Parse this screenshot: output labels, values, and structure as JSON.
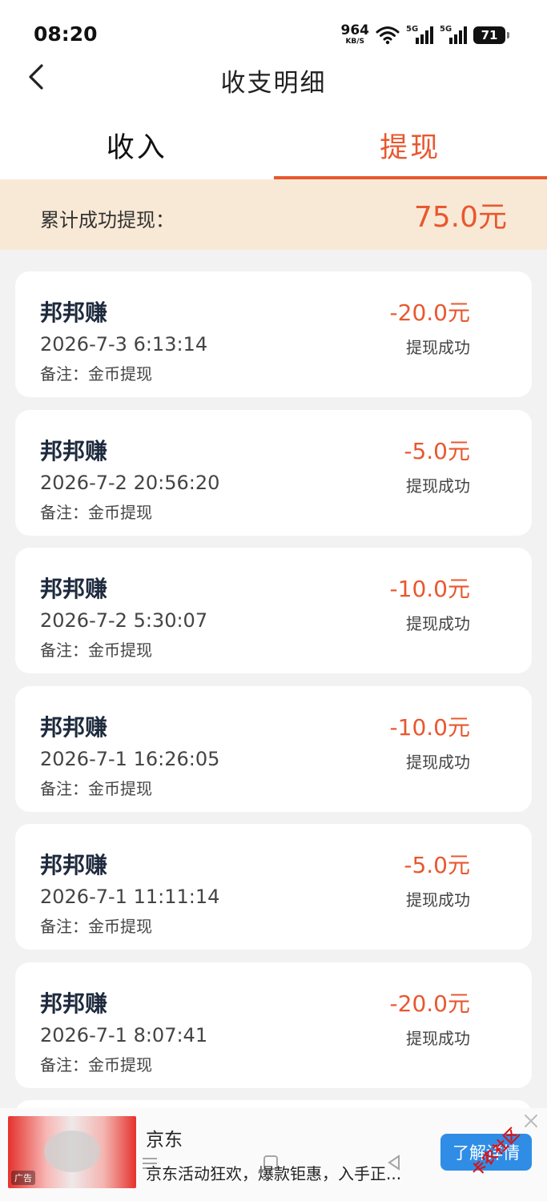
{
  "status_bar": {
    "time": "08:20",
    "net_speed": "964",
    "net_unit": "KB/S",
    "signal_tag": "5G",
    "battery": "71"
  },
  "header": {
    "title": "收支明细"
  },
  "tabs": [
    {
      "label": "收入",
      "active": false
    },
    {
      "label": "提现",
      "active": true
    }
  ],
  "summary": {
    "label": "累计成功提现：",
    "amount": "75.0元"
  },
  "records": [
    {
      "title": "邦邦赚",
      "date": "2026-7-3 6:13:14",
      "note": "备注：金币提现",
      "amount": "-20.0元",
      "status": "提现成功"
    },
    {
      "title": "邦邦赚",
      "date": "2026-7-2 20:56:20",
      "note": "备注：金币提现",
      "amount": "-5.0元",
      "status": "提现成功"
    },
    {
      "title": "邦邦赚",
      "date": "2026-7-2 5:30:07",
      "note": "备注：金币提现",
      "amount": "-10.0元",
      "status": "提现成功"
    },
    {
      "title": "邦邦赚",
      "date": "2026-7-1 16:26:05",
      "note": "备注：金币提现",
      "amount": "-10.0元",
      "status": "提现成功"
    },
    {
      "title": "邦邦赚",
      "date": "2026-7-1 11:11:14",
      "note": "备注：金币提现",
      "amount": "-5.0元",
      "status": "提现成功"
    },
    {
      "title": "邦邦赚",
      "date": "2026-7-1 8:07:41",
      "note": "备注：金币提现",
      "amount": "-20.0元",
      "status": "提现成功"
    }
  ],
  "ad": {
    "badge": "广告",
    "title": "京东",
    "description": "京东活动狂欢，爆款钜惠，入手正...",
    "button": "了解详情"
  },
  "watermark": "卡农社区",
  "colors": {
    "accent": "#e8582f",
    "summary_bg": "#f8e9d6",
    "ad_button": "#2f8de6"
  }
}
